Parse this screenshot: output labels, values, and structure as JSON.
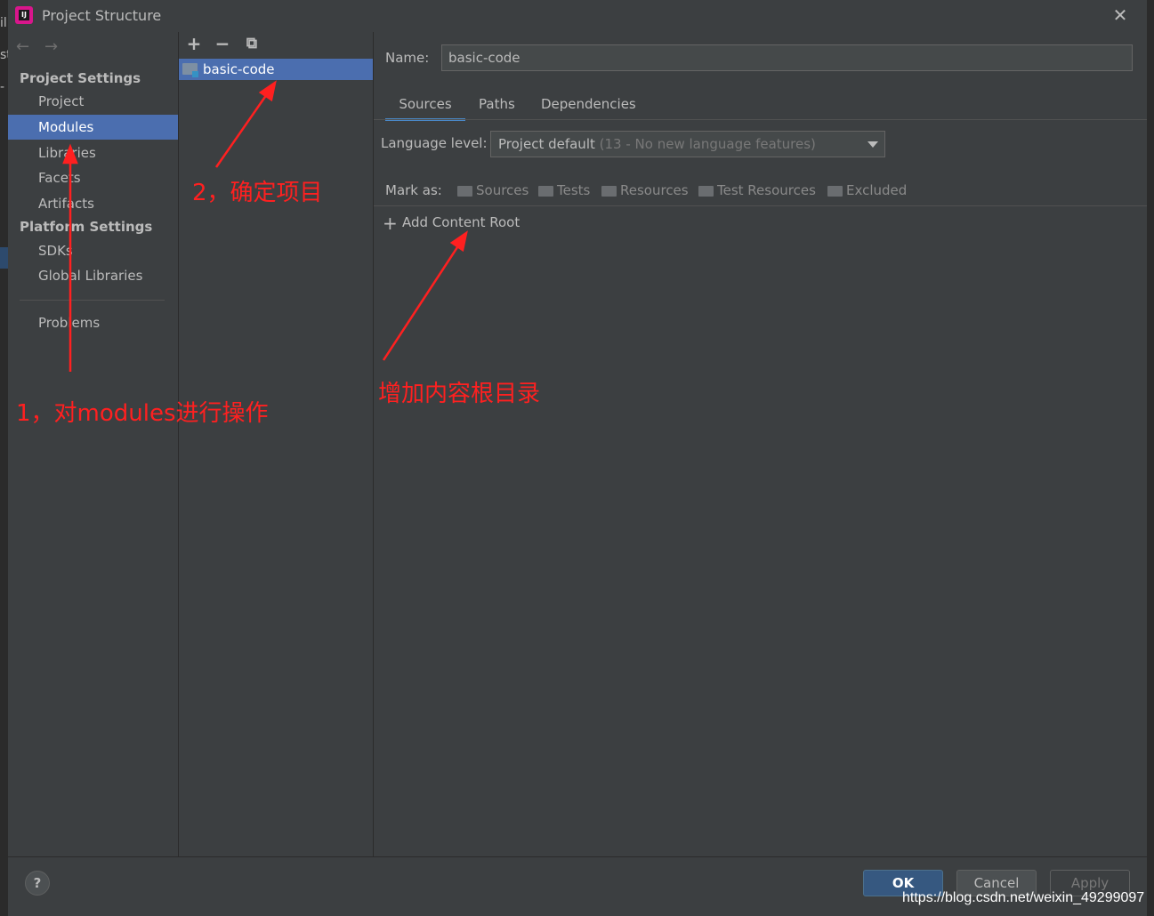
{
  "background": {
    "strip_text": "il\nst\n-"
  },
  "window": {
    "title": "Project Structure",
    "app_icon_text": "IJ"
  },
  "sidebar": {
    "project_settings_header": "Project Settings",
    "project_items": [
      {
        "label": "Project"
      },
      {
        "label": "Modules",
        "selected": true
      },
      {
        "label": "Libraries"
      },
      {
        "label": "Facets"
      },
      {
        "label": "Artifacts"
      }
    ],
    "platform_settings_header": "Platform Settings",
    "platform_items": [
      {
        "label": "SDKs"
      },
      {
        "label": "Global Libraries"
      }
    ],
    "problems_label": "Problems"
  },
  "modules_panel": {
    "toolbar": {
      "add": "+",
      "remove": "−",
      "copy": "⧉"
    },
    "selected_module": "basic-code"
  },
  "details": {
    "name_label": "Name:",
    "name_value": "basic-code",
    "tabs": [
      {
        "label": "Sources",
        "active": true
      },
      {
        "label": "Paths"
      },
      {
        "label": "Dependencies"
      }
    ],
    "language_level_label": "Language level:",
    "language_level_value": "Project default",
    "language_level_hint": "(13 - No new language features)",
    "mark_as_label": "Mark as:",
    "mark_as_items": [
      "Sources",
      "Tests",
      "Resources",
      "Test Resources",
      "Excluded"
    ],
    "add_content_root_label": "Add Content Root"
  },
  "footer": {
    "help": "?",
    "ok": "OK",
    "cancel": "Cancel",
    "apply": "Apply",
    "watermark": "https://blog.csdn.net/weixin_49299097"
  },
  "annotations": {
    "step1": "1，对modules进行操作",
    "step2": "2，确定项目",
    "step3": "增加内容根目录",
    "color": "#ff2020"
  },
  "colors": {
    "selection": "#4b6eaf",
    "panel": "#3c3f41",
    "ok_button": "#365880"
  }
}
